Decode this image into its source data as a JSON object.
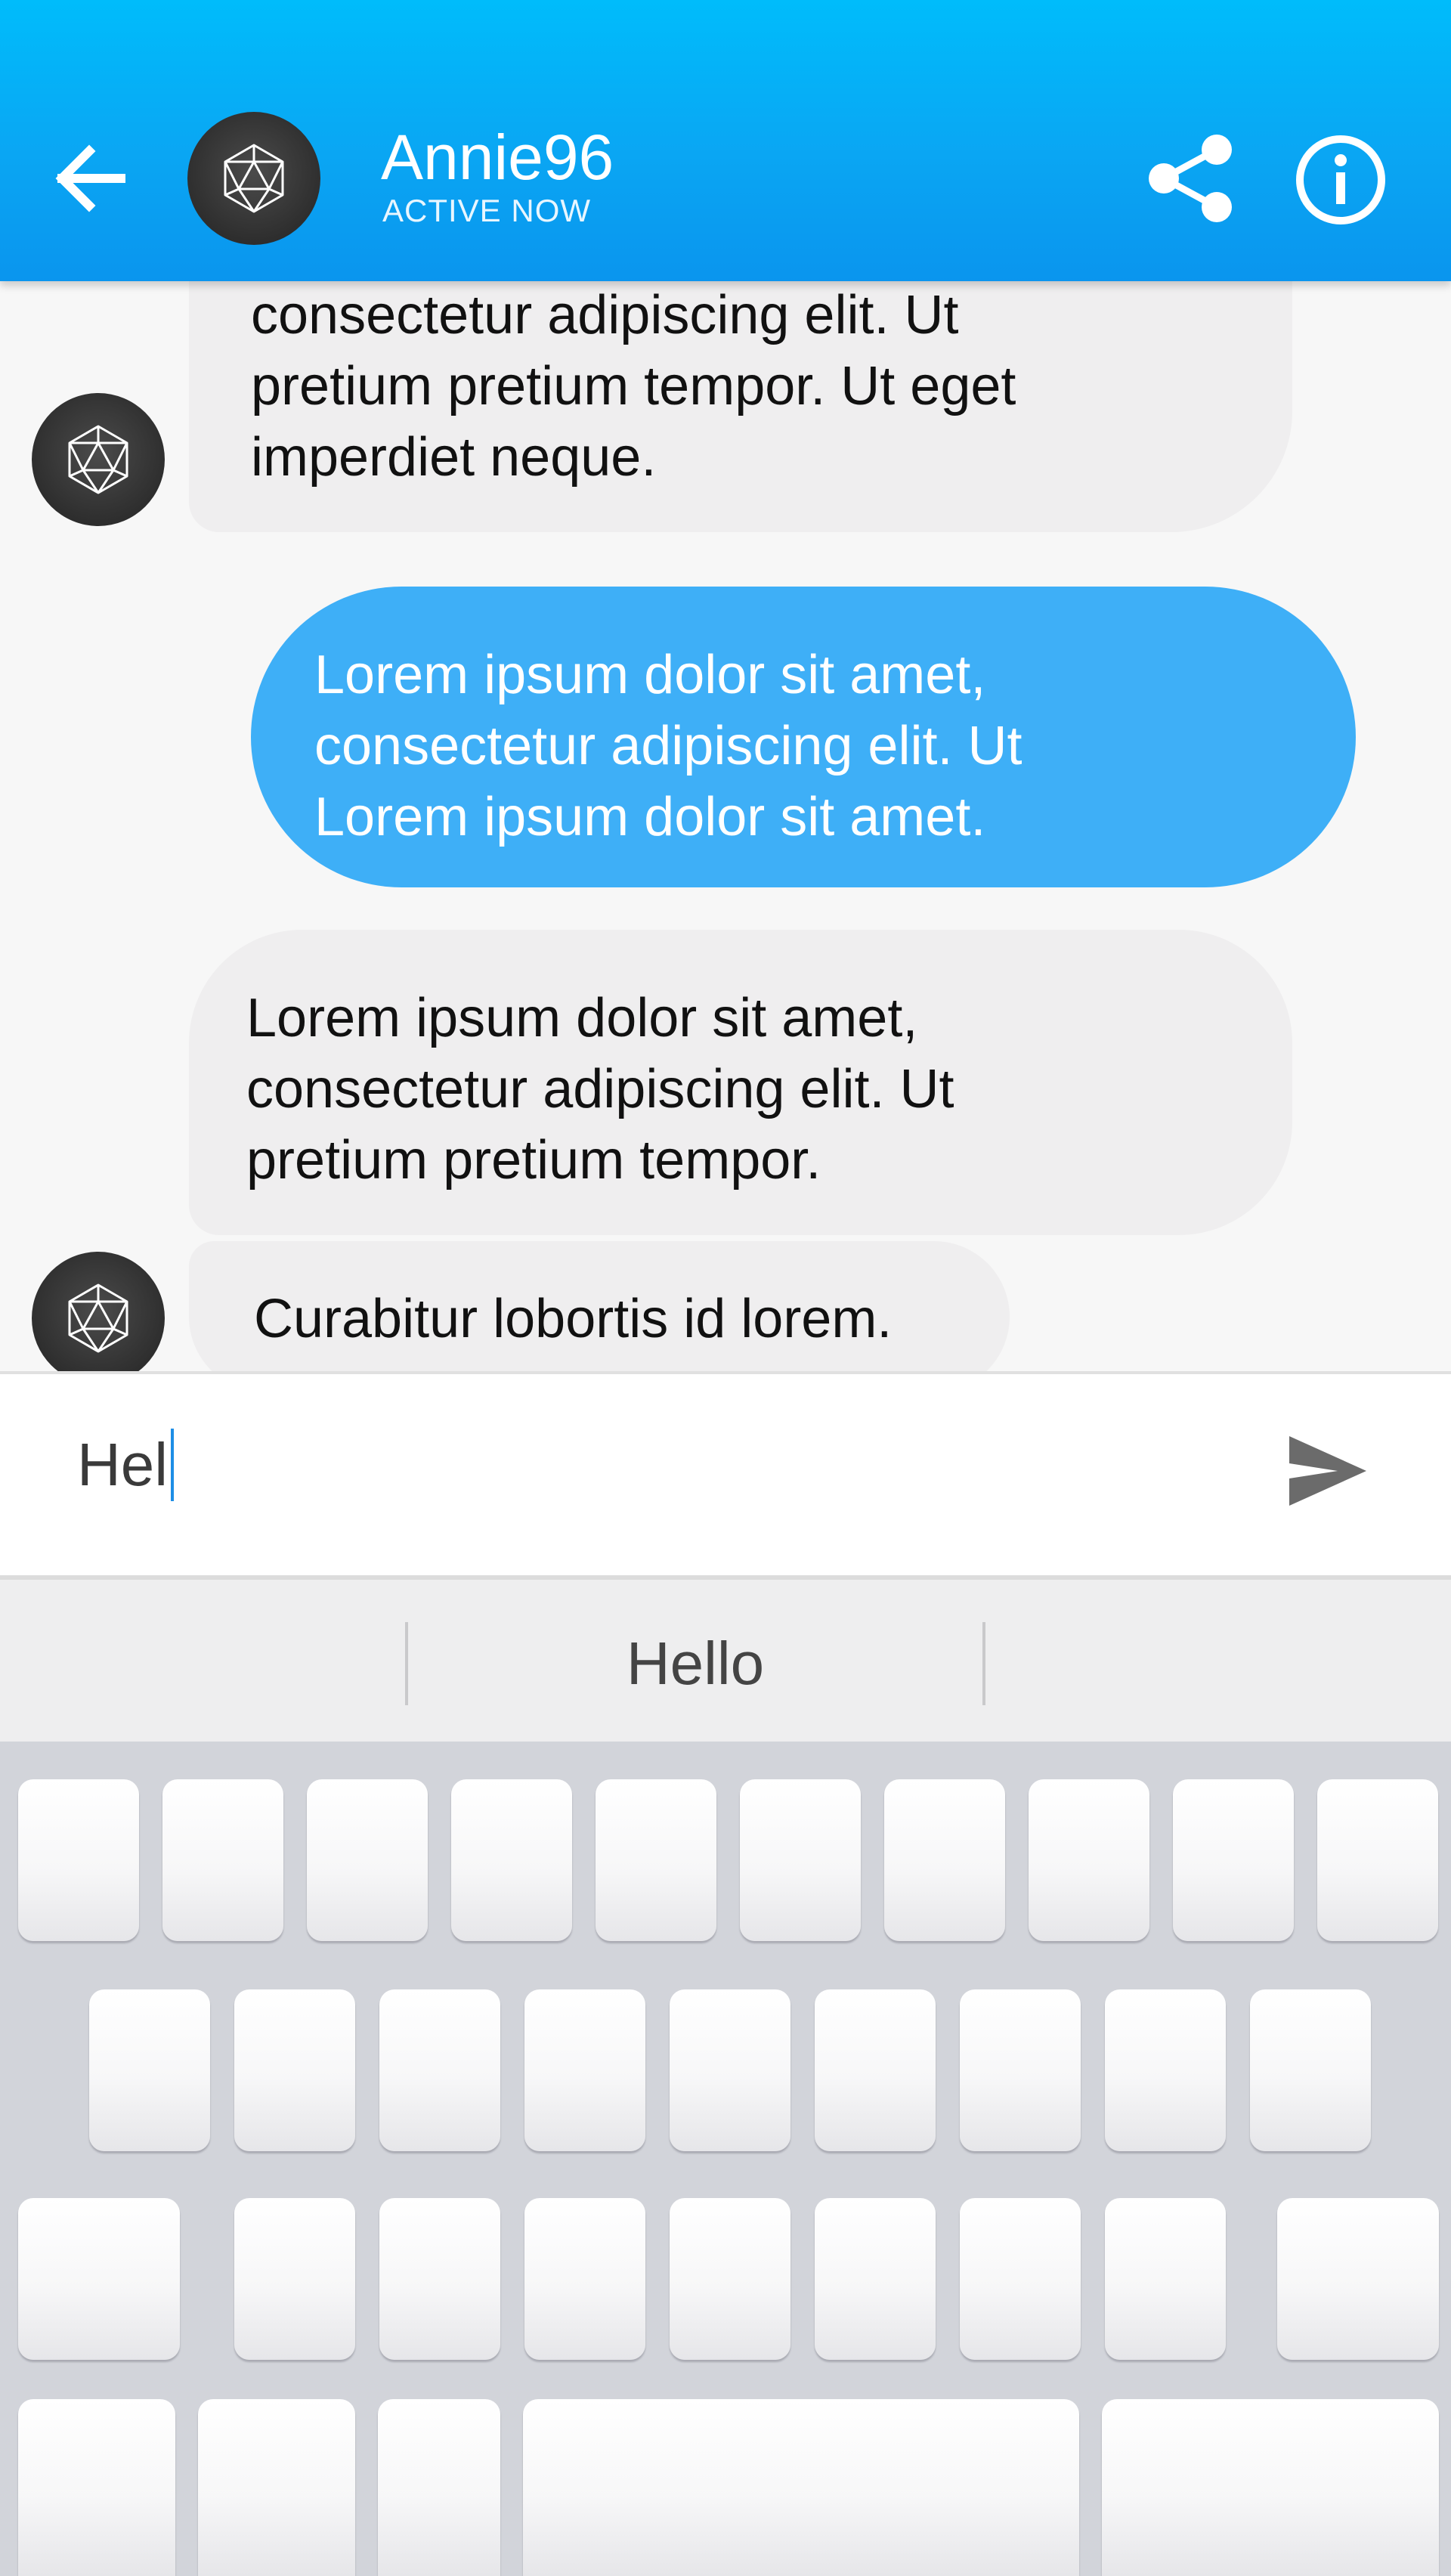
{
  "header": {
    "contact_name": "Annie96",
    "status": "ACTIVE NOW",
    "icons": [
      "back-arrow-icon",
      "avatar-icosahedron-icon",
      "share-icon",
      "info-icon"
    ],
    "gradient_colors": [
      "#00bcfb",
      "#0a95ee"
    ]
  },
  "messages": [
    {
      "direction": "incoming",
      "lines": [
        "consectetur adipiscing elit. Ut",
        "pretium pretium tempor. Ut eget",
        "imperdiet neque."
      ]
    },
    {
      "direction": "outgoing",
      "lines": [
        "Lorem ipsum dolor sit amet,",
        "consectetur adipiscing elit. Ut",
        "Lorem ipsum dolor sit amet."
      ]
    },
    {
      "direction": "incoming",
      "lines": [
        "Lorem ipsum dolor sit amet,",
        "consectetur adipiscing elit. Ut",
        "pretium pretium tempor."
      ]
    },
    {
      "direction": "incoming",
      "lines": [
        "Curabitur lobortis id lorem."
      ]
    }
  ],
  "colors": {
    "outgoing_bubble": "#3eaff7",
    "incoming_bubble": "#efeeef",
    "caret": "#1e8ee6"
  },
  "composer": {
    "value": "Hel",
    "send_icon": "send-icon"
  },
  "keyboard": {
    "suggestion": "Hello"
  }
}
